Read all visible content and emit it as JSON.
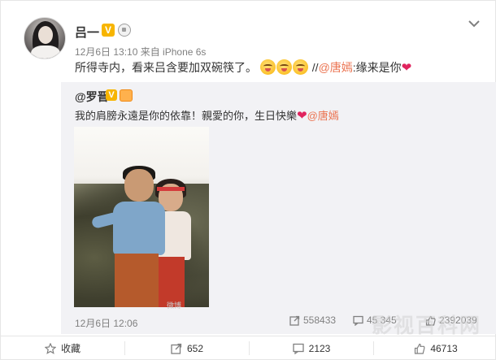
{
  "post": {
    "username": "吕一",
    "meta": "12月6日 13:10 来自 iPhone 6s",
    "text_main": "所得寺内，看来吕含要加双碗筷了。",
    "repost_prefix": "//",
    "mention": "@唐嫣",
    "text_suffix": ":缘来是你",
    "heart": "❤"
  },
  "repost": {
    "username": "@罗晋",
    "text_main": "我的肩膀永遠是你的依靠！親愛的你，生日快樂",
    "heart": "❤",
    "mention": "@唐嫣",
    "photo_watermark": "微博",
    "time": "12月6日 12:06",
    "stats": {
      "reposts": "558433",
      "comments": "45 345",
      "likes": "2392039"
    }
  },
  "actions": {
    "favorite": "收藏",
    "repost": "652",
    "comment": "2123",
    "like": "46713"
  },
  "site_watermark": "影视百科网",
  "colors": {
    "mention": "#eb7350",
    "verified_badge": "#f7b500",
    "heart": "#e0245e",
    "repost_bg": "#f2f2f5"
  },
  "icons": {
    "verified": "V",
    "menu": "chevron-down-icon"
  }
}
